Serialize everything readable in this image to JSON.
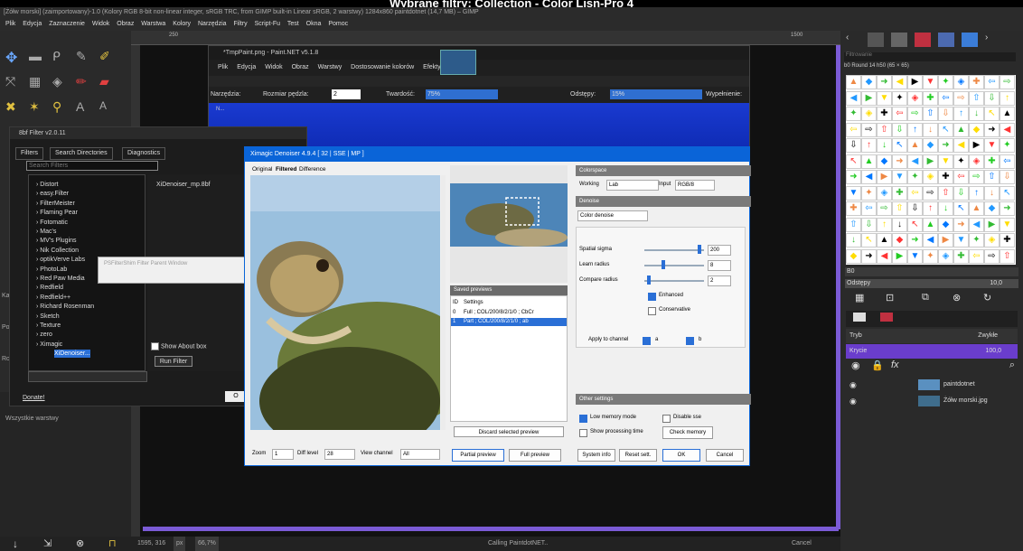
{
  "banner": "Wybrane filtry: Collection - Color Lisn-Pro 4",
  "gimp": {
    "title": "[Żółw morski] (zaimportowany)-1.0 (Kolory RGB 8-bit non-linear integer, sRGB TRC, from GIMP built-in Linear sRGB, 2 warstwy) 1284x860 paintdotnet (14,7 MB) – GIMP",
    "menu": [
      "Plik",
      "Edycja",
      "Zaznaczenie",
      "Widok",
      "Obraz",
      "Warstwa",
      "Kolory",
      "Narzędzia",
      "Filtry",
      "Script-Fu",
      "Test",
      "Okna",
      "Pomoc"
    ],
    "left_lower": {
      "label": "Wszystkie warstwy"
    },
    "status": {
      "coords": "1595, 316",
      "unit": "px",
      "zoom": "66,7%",
      "message": "Calling PaintdotNET..",
      "cancel": "Cancel"
    },
    "ruler_marks": [
      "250",
      "1500"
    ]
  },
  "right_panel": {
    "filter_placeholder": "Filtrowanie",
    "brush_name": "b0 Round 14 h50 (65 × 65)",
    "spacing_label": "Odstępy",
    "spacing_value": "10,0",
    "b0_label": "B0",
    "mode_label": "Tryb",
    "mode_value": "Zwykłe",
    "opacity_label": "Krycie",
    "opacity_value": "100,0",
    "layers": [
      {
        "name": "paintdotnet"
      },
      {
        "name": "Żółw morski.jpg"
      }
    ]
  },
  "paintnet": {
    "title": "*TmpPaint.png - Paint.NET v5.1.8",
    "menu": [
      "Plik",
      "Edycja",
      "Widok",
      "Obraz",
      "Warstwy",
      "Dostosowanie kolorów",
      "Efekty"
    ],
    "opts": {
      "tools": "Narzędzia:",
      "brush_size": "Rozmiar pędzla:",
      "brush_value": "2",
      "hardness": "Twardość:",
      "hardness_value": "75%",
      "spacing": "Odstępy:",
      "spacing_value": "15%",
      "fill": "Wypełnienie:"
    },
    "tab": "N..."
  },
  "bbf": {
    "title": "8bf Filter v2.0.11",
    "tabs": [
      "Filters",
      "Search Directories",
      "Diagnostics"
    ],
    "search_placeholder": "Search Filters",
    "items": [
      "Distort",
      "easy.Filter",
      "FilterMeister",
      "Flaming Pear",
      "Fotomatic",
      "Mac's",
      "MV's Plugins",
      "Nik Collection",
      "optikVerve Labs",
      "PhotoLab",
      "Red Paw Media",
      "Redfield",
      "Redfield++",
      "Richard Rosenman",
      "Sketch",
      "Texture",
      "zero",
      "Ximagic",
      "XiDenoiser..."
    ],
    "selected_file": "XiDenoiser_mp.8bf",
    "show_about": "Show About box",
    "run": "Run Filter",
    "donate": "Donate!",
    "ok_partial": "O"
  },
  "psfilter": {
    "title": "PSFilterShim Filter Parent Window"
  },
  "xid": {
    "title": "Ximagic Denoiser 4.9.4 [ 32 | SSE | MP ]",
    "tabs": [
      "Original",
      "Filtered",
      "Difference"
    ],
    "saved_head": "Saved previews",
    "saved_cols": [
      "ID",
      "Settings"
    ],
    "saved_rows": [
      {
        "id": "0",
        "settings": "Full ; COL/200/8/2/1/0 ; CbCr"
      },
      {
        "id": "1",
        "settings": "Part ; COL/200/8/2/1/0 ; ab"
      }
    ],
    "discard": "Discard selected preview",
    "colorspace": {
      "head": "Colorspace",
      "working_label": "Working",
      "working_value": "Lab",
      "input_label": "Input",
      "input_value": "RGB/8"
    },
    "denoise": {
      "head": "Denoise",
      "method": "Color denoise"
    },
    "params": [
      {
        "label": "Spatial sigma",
        "value": "200",
        "level": 0.95
      },
      {
        "label": "Learn radius",
        "value": "8",
        "level": 0.3
      },
      {
        "label": "Compare radius",
        "value": "2",
        "level": 0.05
      }
    ],
    "enhanced": "Enhanced",
    "conservative": "Conservative",
    "apply_channel": "Apply to channel",
    "ch_a": "a",
    "ch_b": "b",
    "other_head": "Other settings",
    "low_mem": "Low memory mode",
    "disable_sse": "Disable sse",
    "show_time": "Show processing time",
    "check_mem": "Check memory",
    "zoom_label": "Zoom",
    "zoom_value": "1",
    "diff_label": "Diff level",
    "diff_value": "28",
    "view_label": "View channel",
    "view_value": "All",
    "partial": "Partial preview",
    "full": "Full preview",
    "sysinfo": "System info",
    "reset": "Reset sett.",
    "ok": "OK",
    "cancel": "Cancel"
  },
  "colors": {
    "accent": "#0a64d8",
    "purple": "#7b5bd6",
    "gimp_bg": "#2a2a2a"
  }
}
